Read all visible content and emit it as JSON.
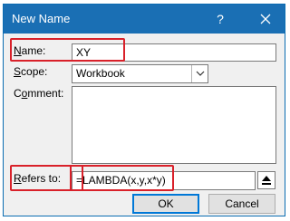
{
  "dialog": {
    "title": "New Name",
    "help_glyph": "?",
    "close_glyph": "✕"
  },
  "name": {
    "label_accel": "N",
    "label_rest": "ame:",
    "value": "XY"
  },
  "scope": {
    "label_accel": "S",
    "label_rest": "cope:",
    "value": "Workbook"
  },
  "comment": {
    "label_prefix": "C",
    "label_accel": "o",
    "label_rest": "mment:",
    "value": ""
  },
  "refers_to": {
    "label_accel": "R",
    "label_rest": "efers to:",
    "value": "=LAMBDA(x,y,x*y)"
  },
  "buttons": {
    "ok": "OK",
    "cancel": "Cancel"
  },
  "colors": {
    "titlebar": "#1a6fb4",
    "highlight": "#d9212a"
  },
  "icons": {
    "scope_dropdown": "chevron-down-icon",
    "collapse": "collapse-dialog-icon"
  }
}
